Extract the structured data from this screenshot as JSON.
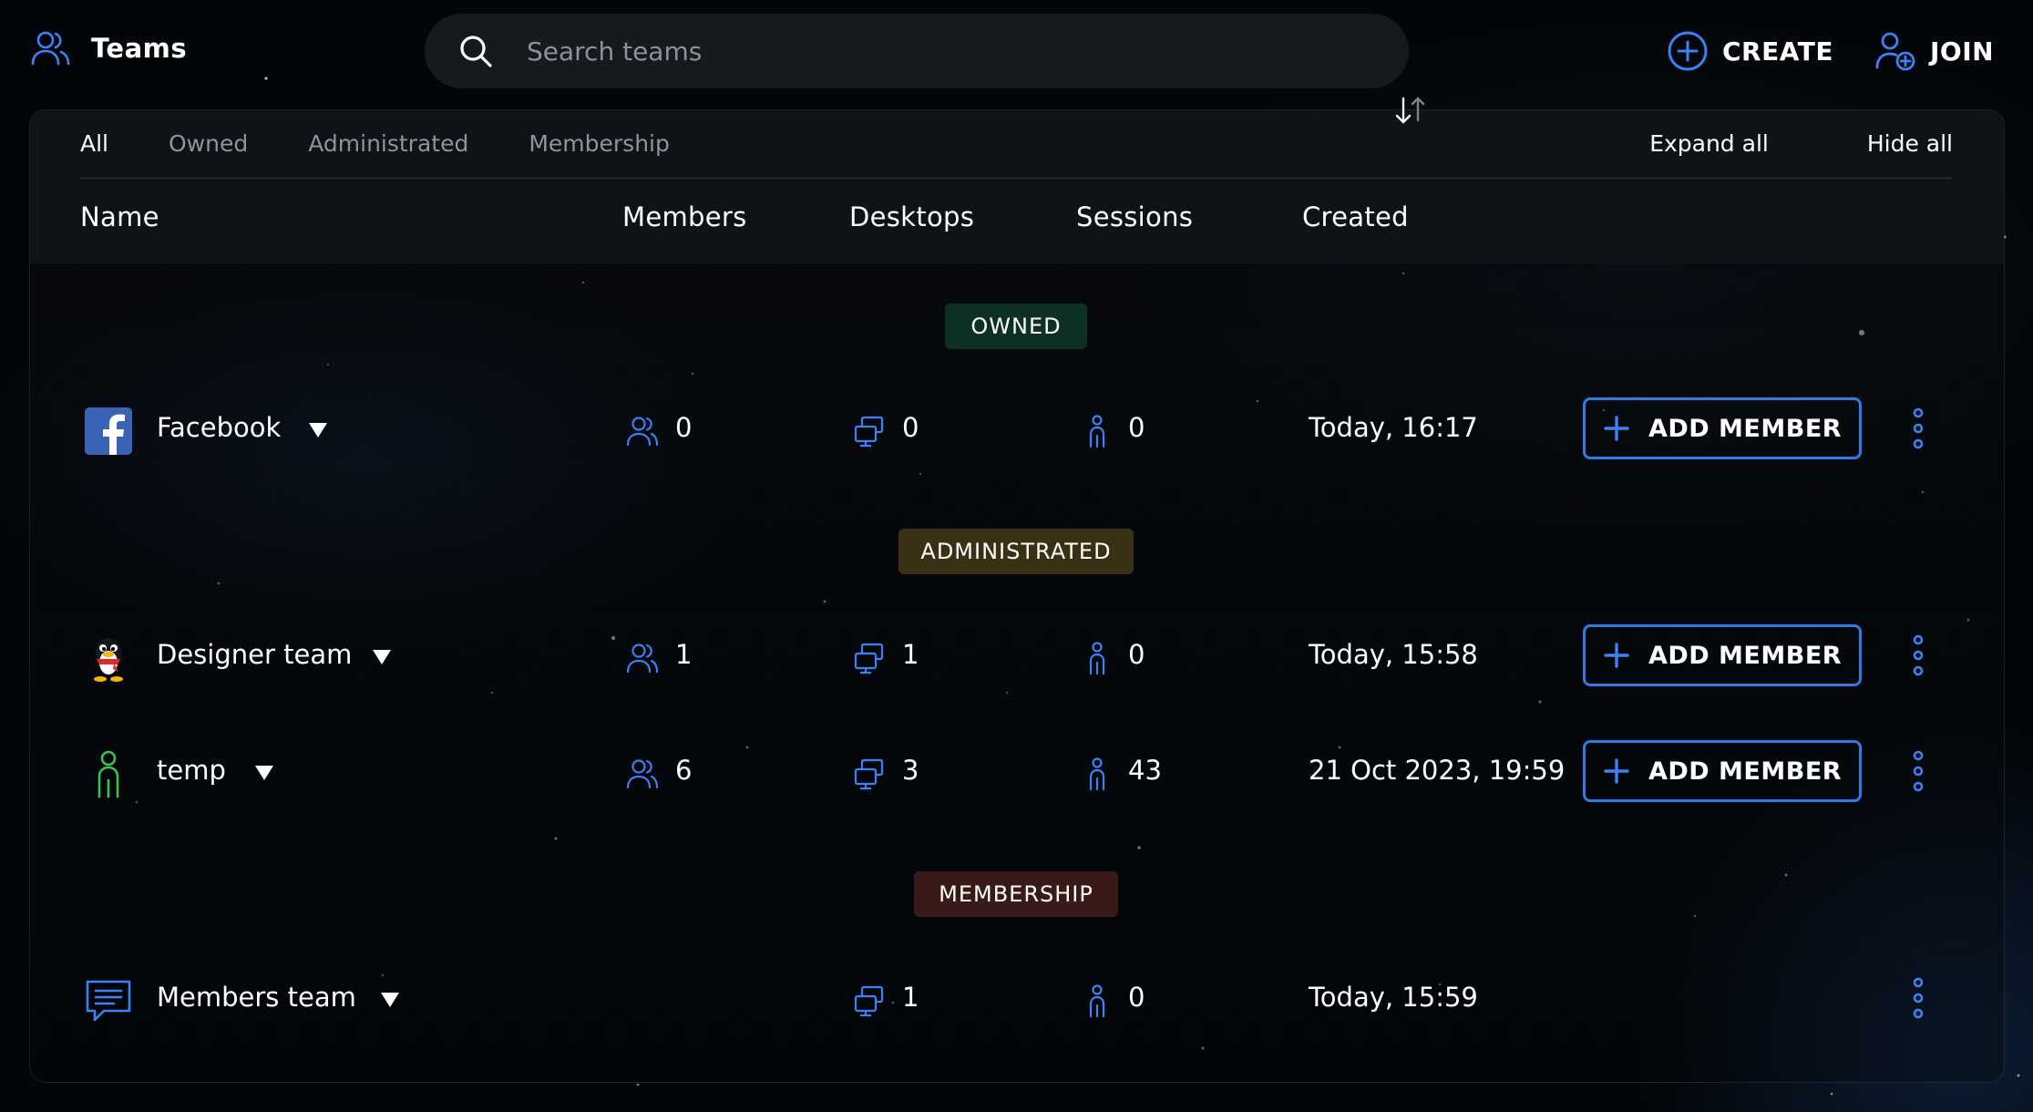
{
  "header": {
    "title": "Teams",
    "search_placeholder": "Search teams",
    "create_label": "CREATE",
    "join_label": "JOIN"
  },
  "tabs": [
    {
      "label": "All",
      "active": true
    },
    {
      "label": "Owned",
      "active": false
    },
    {
      "label": "Administrated",
      "active": false
    },
    {
      "label": "Membership",
      "active": false
    }
  ],
  "tab_actions": {
    "expand_all": "Expand all",
    "hide_all": "Hide all"
  },
  "columns": {
    "name": "Name",
    "members": "Members",
    "desktops": "Desktops",
    "sessions": "Sessions",
    "created": "Created"
  },
  "sections": {
    "owned": "OWNED",
    "administrated": "ADMINISTRATED",
    "membership": "MEMBERSHIP"
  },
  "teams": [
    {
      "name": "Facebook",
      "icon": "facebook-icon",
      "members": "0",
      "desktops": "0",
      "sessions": "0",
      "created": "Today, 16:17",
      "action": "ADD MEMBER"
    },
    {
      "name": "Designer team",
      "icon": "penguin-icon",
      "members": "1",
      "desktops": "1",
      "sessions": "0",
      "created": "Today, 15:58",
      "action": "ADD MEMBER"
    },
    {
      "name": "temp",
      "icon": "person-icon",
      "members": "6",
      "desktops": "3",
      "sessions": "43",
      "created": "21 Oct 2023, 19:59",
      "action": "ADD MEMBER"
    },
    {
      "name": "Members team",
      "icon": "chat-icon",
      "desktops": "1",
      "sessions": "0",
      "created": "Today, 15:59"
    }
  ],
  "colors": {
    "accent": "#2f7ae5",
    "owned_badge": "#0d3025",
    "administrated_badge": "#3a3014",
    "membership_badge": "#3a1a18",
    "panel": "#101317"
  }
}
